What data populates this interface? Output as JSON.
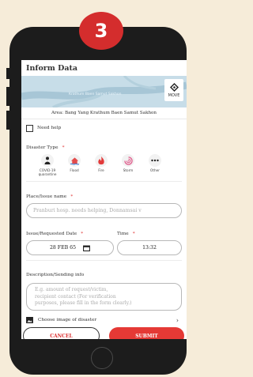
{
  "step_badge": "3",
  "header": {
    "title": "Inform Data"
  },
  "map": {
    "label": "Krathum Baen Samut Sakhon",
    "move_label": "MOVE"
  },
  "area": "Area: Bang Yang Krathum Baen Samut Sakhon",
  "need_help_label": "Need help",
  "disaster_type": {
    "label": "Disaster Type",
    "required": "*",
    "items": [
      {
        "label": "COVID-19 quarantine",
        "icon": "person-icon"
      },
      {
        "label": "Flood",
        "icon": "flood-house-icon"
      },
      {
        "label": "Fire",
        "icon": "fire-icon"
      },
      {
        "label": "Storm",
        "icon": "storm-icon"
      },
      {
        "label": "Other",
        "icon": "more-icon"
      }
    ]
  },
  "place": {
    "label": "Place/Issue name",
    "required": "*",
    "placeholder": "Pranburi hosp. needs helping, Donnamsai v"
  },
  "date": {
    "label": "Issue/Requested Date",
    "required": "*",
    "value": "28 FEB 65"
  },
  "time": {
    "label": "Time",
    "required": "*",
    "value": "13:32"
  },
  "description": {
    "label": "Description/Sending info",
    "placeholder_lines": [
      "E.g. amount of request/victim,",
      "recipient contact (For verification",
      "purposes, please fill in the form clearly.)"
    ]
  },
  "choose_image_label": "Choose image of disaster",
  "buttons": {
    "cancel": "CANCEL",
    "submit": "SUBMIT"
  },
  "colors": {
    "accent": "#e53935",
    "badge": "#d42d2d",
    "phone_body": "#1c1c1c",
    "background": "#f6ecd9"
  }
}
